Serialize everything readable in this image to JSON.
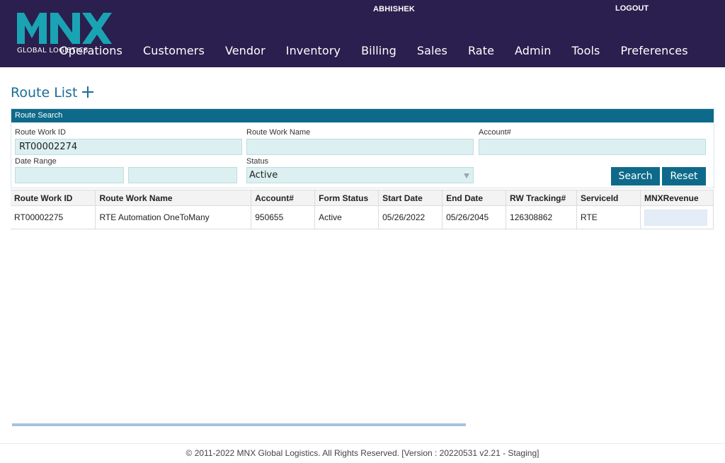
{
  "header": {
    "logo_text": "MNX",
    "logo_sub": "GLOBAL LOGISTICS",
    "user": "ABHISHEK",
    "logout_label": "LOGOUT",
    "nav": [
      "Operations",
      "Customers",
      "Vendor",
      "Inventory",
      "Billing",
      "Sales",
      "Rate",
      "Admin",
      "Tools",
      "Preferences"
    ]
  },
  "page": {
    "title": "Route List"
  },
  "search": {
    "panel_title": "Route Search",
    "route_work_id_label": "Route Work ID",
    "route_work_id_value": "RT00002274",
    "route_work_name_label": "Route Work Name",
    "route_work_name_value": "",
    "account_label": "Account#",
    "account_value": "",
    "date_range_label": "Date Range",
    "date_from": "",
    "date_to": "",
    "status_label": "Status",
    "status_value": "Active",
    "search_button": "Search",
    "reset_button": "Reset"
  },
  "table": {
    "columns": [
      "Route Work ID",
      "Route Work Name",
      "Account#",
      "Form Status",
      "Start Date",
      "End Date",
      "RW Tracking#",
      "ServiceId",
      "MNXRevenue"
    ],
    "rows": [
      [
        "RT00002275",
        "RTE Automation OneToMany",
        "950655",
        "Active",
        "05/26/2022",
        "05/26/2045",
        "126308862",
        "RTE",
        ""
      ]
    ]
  },
  "footer": {
    "text": "© 2011-2022 MNX Global Logistics. All Rights Reserved. [Version : 20220531 v2.21 - Staging]"
  },
  "colors": {
    "header_bg": "#2a1f4e",
    "logo": "#1aa3b3",
    "accent": "#0e6a8a",
    "title": "#1a6d96",
    "input_bg": "#ddf0f1"
  },
  "icons": {
    "add": "plus-icon",
    "dropdown": "chevron-down-icon"
  }
}
